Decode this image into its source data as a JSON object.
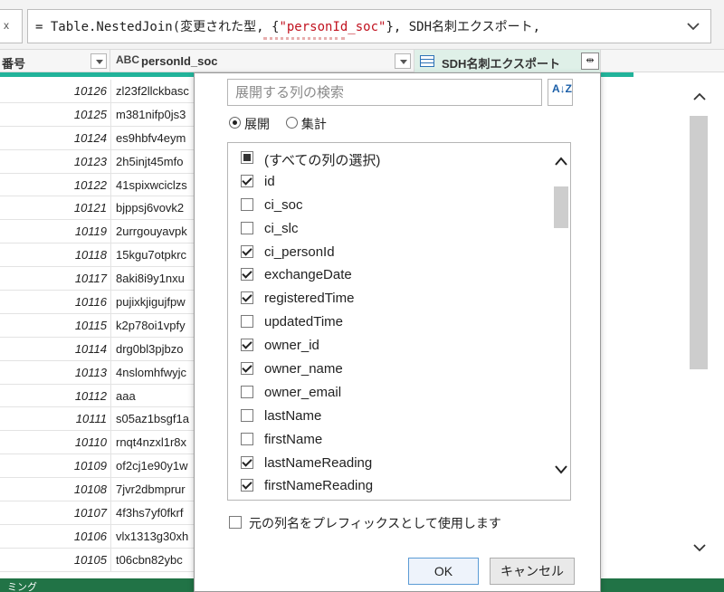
{
  "formula": {
    "stub_text": "x",
    "prefix": "= Table.NestedJoin(変更された型, {",
    "string_arg": "\"personId_soc\"",
    "suffix": "}, SDH名刺エクスポート,"
  },
  "columns": {
    "col_a_label": "番号",
    "col_b_type": "ABC",
    "col_b_label": "personId_soc",
    "col_c_label": "SDH名刺エクスポート"
  },
  "rows": [
    {
      "num": "10126",
      "text": "zl23f2llckbasc"
    },
    {
      "num": "10125",
      "text": "m381nifp0js3"
    },
    {
      "num": "10124",
      "text": "es9hbfv4eym"
    },
    {
      "num": "10123",
      "text": "2h5injt45mfo"
    },
    {
      "num": "10122",
      "text": "41spixwciclzs"
    },
    {
      "num": "10121",
      "text": "bjppsj6vovk2"
    },
    {
      "num": "10119",
      "text": "2urrgouyavpk"
    },
    {
      "num": "10118",
      "text": "15kgu7otpkrc"
    },
    {
      "num": "10117",
      "text": "8aki8i9y1nxu"
    },
    {
      "num": "10116",
      "text": "pujixkjigujfpw"
    },
    {
      "num": "10115",
      "text": "k2p78oi1vpfy"
    },
    {
      "num": "10114",
      "text": "drg0bl3pjbzo"
    },
    {
      "num": "10113",
      "text": "4nslomhfwyjc"
    },
    {
      "num": "10112",
      "text": "aaa"
    },
    {
      "num": "10111",
      "text": "s05az1bsgf1a"
    },
    {
      "num": "10110",
      "text": "rnqt4nzxl1r8x"
    },
    {
      "num": "10109",
      "text": "of2cj1e90y1w"
    },
    {
      "num": "10108",
      "text": "7jvr2dbmprur"
    },
    {
      "num": "10107",
      "text": "4f3hs7yf0fkrf"
    },
    {
      "num": "10106",
      "text": "vlx1313g30xh"
    },
    {
      "num": "10105",
      "text": "t06cbn82ybc"
    }
  ],
  "status": {
    "text": "ミング"
  },
  "popup": {
    "search_placeholder": "展開する列の検索",
    "sort_icon_text": "A↓Z",
    "radio_expand": "展開",
    "radio_aggregate": "集計",
    "items": [
      {
        "label": "(すべての列の選択)",
        "state": "partial"
      },
      {
        "label": "id",
        "state": "checked"
      },
      {
        "label": "ci_soc",
        "state": "unchecked"
      },
      {
        "label": "ci_slc",
        "state": "unchecked"
      },
      {
        "label": "ci_personId",
        "state": "checked"
      },
      {
        "label": "exchangeDate",
        "state": "checked"
      },
      {
        "label": "registeredTime",
        "state": "checked"
      },
      {
        "label": "updatedTime",
        "state": "unchecked"
      },
      {
        "label": "owner_id",
        "state": "checked"
      },
      {
        "label": "owner_name",
        "state": "checked"
      },
      {
        "label": "owner_email",
        "state": "unchecked"
      },
      {
        "label": "lastName",
        "state": "unchecked"
      },
      {
        "label": "firstName",
        "state": "unchecked"
      },
      {
        "label": "lastNameReading",
        "state": "checked"
      },
      {
        "label": "firstNameReading",
        "state": "checked"
      }
    ],
    "prefix_label": "元の列名をプレフィックスとして使用します",
    "ok_label": "OK",
    "cancel_label": "キャンセル"
  },
  "colors": {
    "accent": "#22b39a",
    "status_bar": "#217346",
    "formula_string": "#c1121f"
  }
}
